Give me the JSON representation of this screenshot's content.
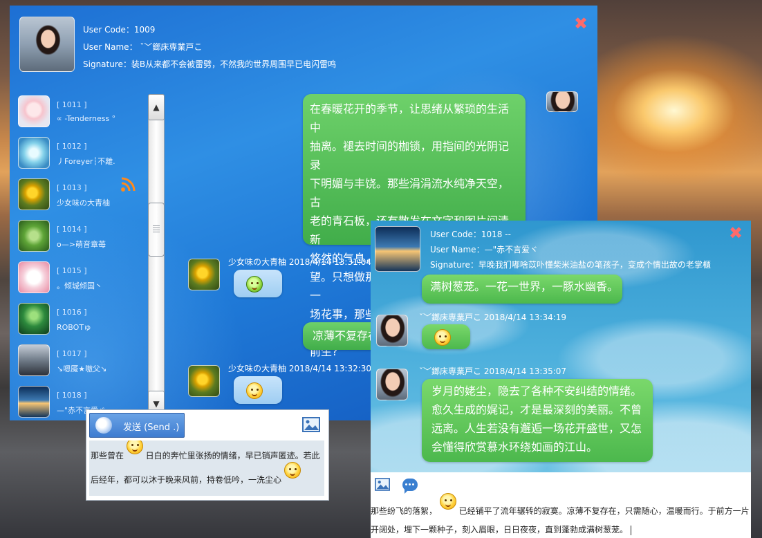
{
  "main_window": {
    "user_code": "User Code：1009",
    "user_name": "User Name：  ˇ﹀鎯床専業戸こ",
    "signature": "Signature：装B从来都不会被雷劈，不然我的世界周围早已电闪雷鸣",
    "close_glyph": "✖",
    "friends": [
      {
        "code": "[ 1011 ]",
        "name": "∝ -Tenderness °",
        "avatar": "doll"
      },
      {
        "code": "[ 1012 ]",
        "name": "丿Foreyer┆不離.",
        "avatar": "anime"
      },
      {
        "code": "[ 1013 ]",
        "name": "少女味の大青柚",
        "avatar": "flower"
      },
      {
        "code": "[ 1014 ]",
        "name": "o—>萌音章苺",
        "avatar": "clover"
      },
      {
        "code": "[ 1015 ]",
        "name": "。倾城倾国丶",
        "avatar": "kitty"
      },
      {
        "code": "[ 1016 ]",
        "name": "ROBOTゅ",
        "avatar": "forest"
      },
      {
        "code": "[ 1017 ]",
        "name": "↘嗯魇★嗷父↘",
        "avatar": "storm"
      },
      {
        "code": "[ 1018 ]",
        "name": "—\"赤不言爱ヾ",
        "avatar": "lake"
      }
    ],
    "messages": {
      "outgoing_1_lines": [
        "在春暖花开的季节，让思绪从繁琐的生活中",
        "抽离。褪去时间的枷锁，用指间的光阴记录",
        "下明媚与丰饶。那些涓涓流水纯净天空，古",
        "老的青石板，还有散发在文字和图片间清新",
        "悠然的气息，总会触动心底跃然而出的渴",
        "望。只想做那不动声色的男子，信步去读一",
        "场花事，那些明眸若水的记忆，可就是我的",
        "前生?"
      ],
      "incoming_1_sender": "少女味の大青柚  2018/4/14 13:31:04",
      "outgoing_2_text": "凉薄不复存在",
      "incoming_2_sender": "少女味の大青柚  2018/4/14 13:32:30"
    }
  },
  "send_panel": {
    "send_label": "发送 (Send .)",
    "compose_line_1a": "那些曾在",
    "compose_line_1b": "日白的奔忙里张扬的情绪，早已销声匿迹。若此",
    "compose_line_2": "后经年，都可以沐于晚来风前，持卷低吟，一洗尘心"
  },
  "second_window": {
    "user_code": "User Code：1018       --",
    "user_name": "User Name：—\"赤不言爱ヾ",
    "signature": "Signature：早晚我扪嘟啥苡卟懂柴米油盐の笔孩子，变成个情出故の老掌櫃",
    "close_glyph": "✖",
    "partial_bubble_text": "满树葱茏。一花一世界，一豚水幽香。",
    "msg1_sender": "ˇ﹀鎯床専業戸こ  2018/4/14 13:34:19",
    "msg2_sender": "ˇ﹀鎯床専業戸こ  2018/4/14 13:35:07",
    "msg2_lines": [
      "岁月的姥尘，隐去了各种不安纠结的情绪。",
      "愈久生成的娓记，才是最深刻的美丽。不曾",
      "远离。人生若没有邂逅一场花开盛世，又怎",
      "会懂得欣赏慕水环绕如画的江山。"
    ],
    "compose_line_1a": "那些纷飞的落絮，",
    "compose_line_1b": "已经铺平了流年辗转的寂寞。凉薄不复存在，只需随心，温暖而行。于前方一片",
    "compose_line_2": "开阔处，埋下一颗种子，刻入眉眼，日日夜夜，直到蓬勃成满树葱茏。"
  },
  "colors": {
    "main_window_blue": "#1f79d7",
    "bubble_green": "#41ad4a",
    "bubble_blue": "#9ecdf2",
    "close_red": "#ff6b6b"
  }
}
